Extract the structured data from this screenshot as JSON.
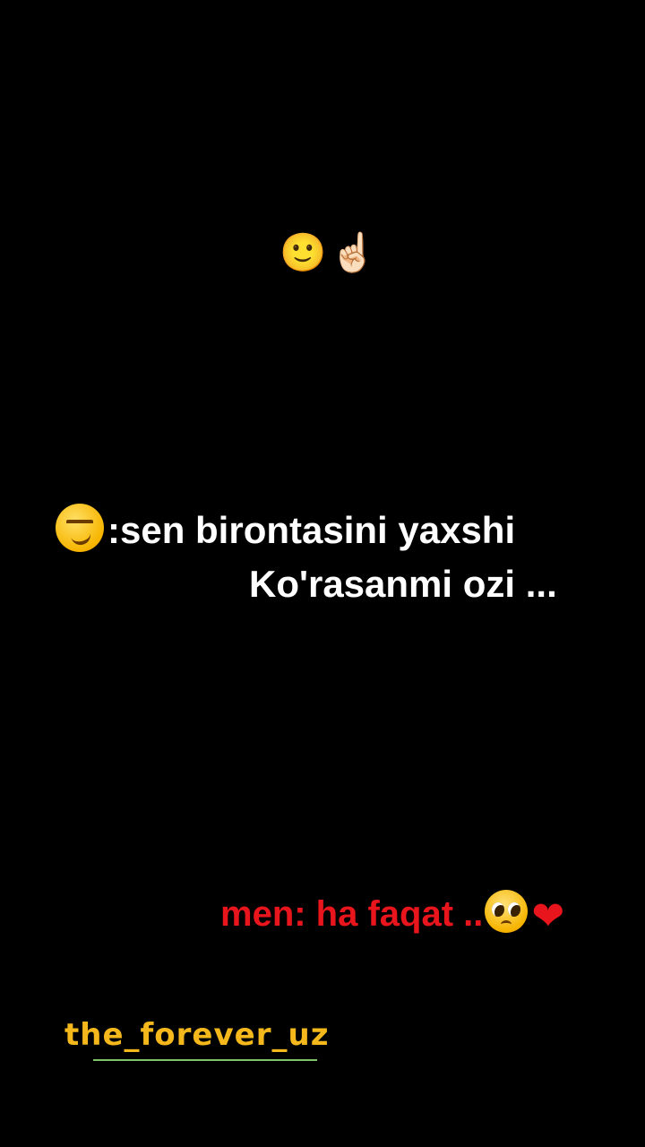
{
  "top_emojis": "🙂☝🏻",
  "message": {
    "line1": ":sen birontasini yaxshi",
    "line2": "Ko'rasanmi ozi ..."
  },
  "reply": {
    "text": "men: ha faqat ..",
    "heart": "❤"
  },
  "watermark": "the_forever_uz",
  "colors": {
    "background": "#000000",
    "message_text": "#ffffff",
    "reply_text": "#e8151d",
    "watermark": "#f5b81c",
    "underline": "#7fc46b"
  },
  "icons": [
    "slightly-smiling-face-icon",
    "pointing-up-icon",
    "smirking-face-icon",
    "pleading-face-icon",
    "red-heart-icon"
  ]
}
